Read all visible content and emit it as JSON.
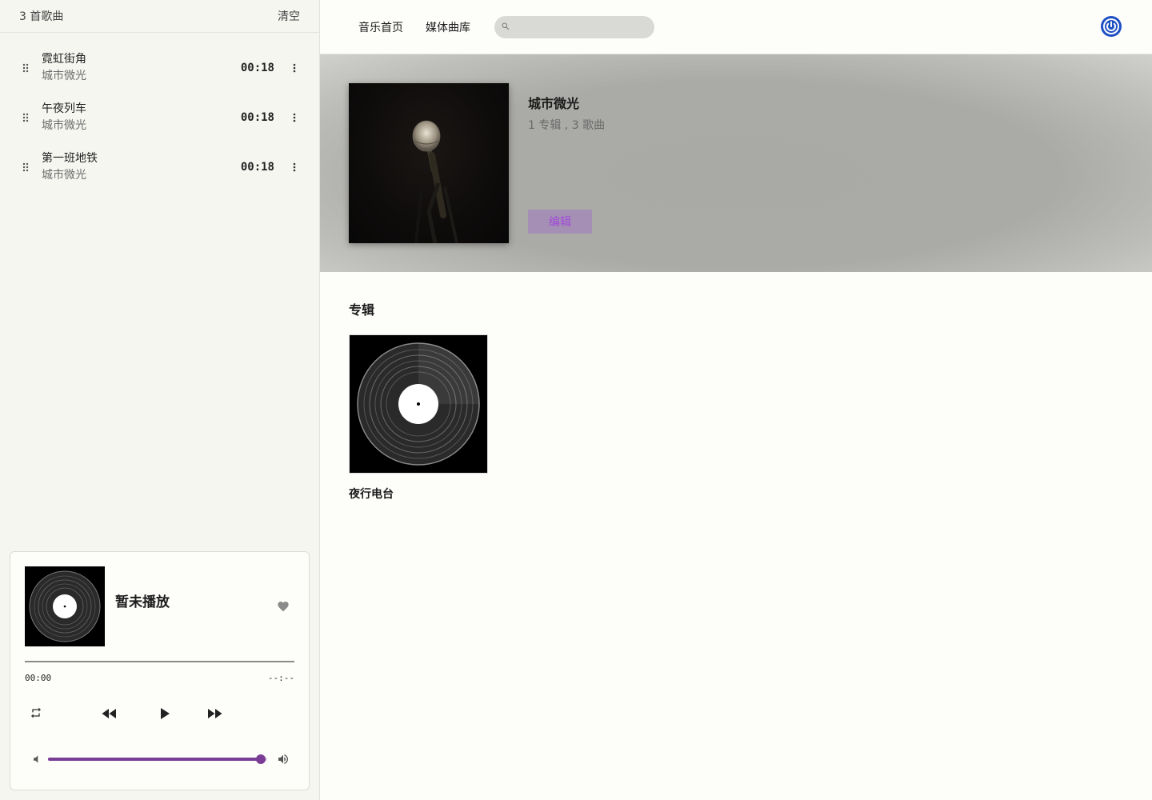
{
  "queue": {
    "count_label": "3 首歌曲",
    "clear_label": "清空",
    "tracks": [
      {
        "title": "霓虹街角",
        "artist": "城市微光",
        "duration": "00:18"
      },
      {
        "title": "午夜列车",
        "artist": "城市微光",
        "duration": "00:18"
      },
      {
        "title": "第一班地铁",
        "artist": "城市微光",
        "duration": "00:18"
      }
    ]
  },
  "player": {
    "now_playing": "暂未播放",
    "time_current": "00:00",
    "time_total": "--:--",
    "volume_fraction": 0.97
  },
  "nav": {
    "home": "音乐首页",
    "library": "媒体曲库",
    "search_placeholder": ""
  },
  "artist": {
    "name": "城市微光",
    "stats": "1 专辑 , 3 歌曲",
    "edit_label": "编辑"
  },
  "albums": {
    "section_title": "专辑",
    "items": [
      {
        "name": "夜行电台"
      }
    ]
  },
  "colors": {
    "accent": "#7a3d95",
    "power_icon": "#1e4fc2"
  }
}
